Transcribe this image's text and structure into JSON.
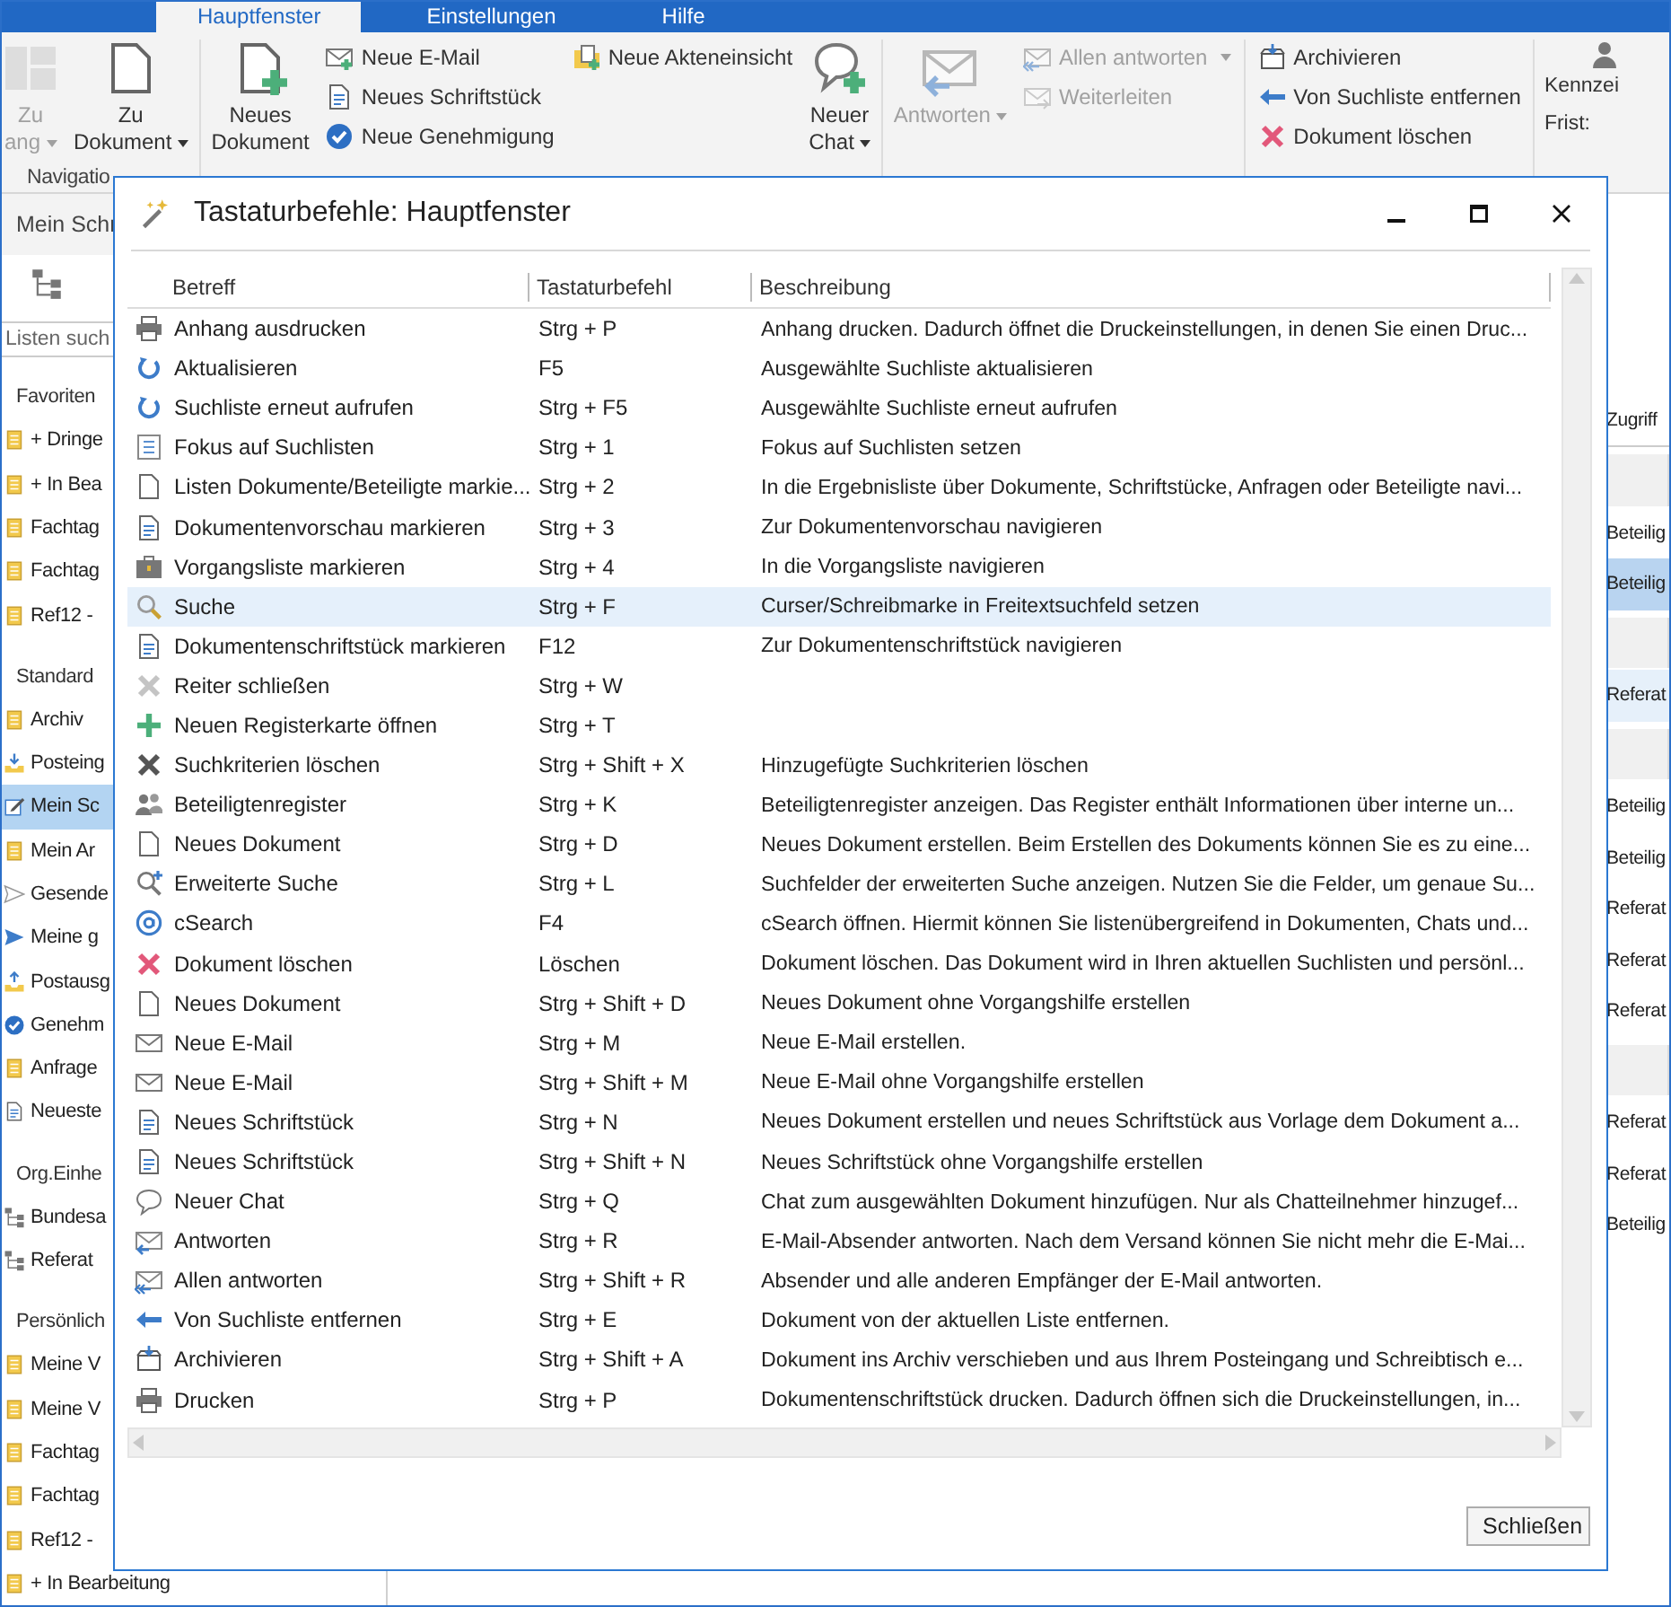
{
  "ribbon": {
    "tabs": [
      {
        "label": "Hauptfenster",
        "selected": true
      },
      {
        "label": "Einstellungen",
        "selected": false
      },
      {
        "label": "Hilfe",
        "selected": false
      }
    ],
    "groups": [
      {
        "label": "Navigatio",
        "columns": [
          {
            "kind": "large",
            "buttons": [
              {
                "kind": "panels",
                "lines": [
                  "Zu",
                  "ang"
                ],
                "dropdown": true,
                "disabled": true
              }
            ]
          },
          {
            "kind": "large",
            "buttons": [
              {
                "kind": "doc",
                "lines": [
                  "Zu",
                  "Dokument"
                ],
                "dropdown": true,
                "disabled": false
              }
            ]
          }
        ]
      },
      {
        "columns": [
          {
            "kind": "large",
            "buttons": [
              {
                "kind": "newdoc",
                "lines": [
                  "Neues",
                  "Dokument"
                ],
                "dropdown": false,
                "disabled": false
              }
            ]
          },
          {
            "kind": "stack",
            "buttons": [
              {
                "kind": "mailplus",
                "lines": [
                  "Neue E-Mail"
                ],
                "dropdown": false,
                "disabled": false
              },
              {
                "kind": "textdoc",
                "lines": [
                  "Neues Schriftstück"
                ],
                "dropdown": false,
                "disabled": false
              },
              {
                "kind": "check",
                "lines": [
                  "Neue Genehmigung"
                ],
                "dropdown": false,
                "disabled": false
              }
            ]
          },
          {
            "kind": "stack",
            "buttons": [
              {
                "kind": "folder",
                "lines": [
                  "Neue Akteneinsicht"
                ],
                "dropdown": false,
                "disabled": false
              }
            ]
          },
          {
            "kind": "large",
            "buttons": [
              {
                "kind": "chatplus",
                "lines": [
                  "Neuer",
                  "Chat"
                ],
                "dropdown": true,
                "disabled": false
              }
            ]
          }
        ]
      },
      {
        "columns": [
          {
            "kind": "large",
            "buttons": [
              {
                "kind": "reply",
                "lines": [
                  "Antworten"
                ],
                "dropdown": true,
                "disabled": true
              }
            ]
          },
          {
            "kind": "stack",
            "buttons": [
              {
                "kind": "replyall",
                "lines": [
                  "Allen antworten"
                ],
                "dropdown": true,
                "disabled": true
              },
              {
                "kind": "forward",
                "lines": [
                  "Weiterleiten"
                ],
                "dropdown": false,
                "disabled": true
              }
            ]
          }
        ]
      },
      {
        "columns": [
          {
            "kind": "stack",
            "buttons": [
              {
                "kind": "archive",
                "lines": [
                  "Archivieren"
                ],
                "dropdown": false,
                "disabled": false
              },
              {
                "kind": "arrowleft",
                "lines": [
                  "Von Suchliste entfernen"
                ],
                "dropdown": false,
                "disabled": false
              },
              {
                "kind": "xred",
                "lines": [
                  "Dokument löschen"
                ],
                "dropdown": false,
                "disabled": false
              }
            ]
          }
        ]
      },
      {
        "columns": [
          {
            "kind": "fields",
            "buttons": [
              {
                "kind": "person",
                "lines": [
                  "Kennzei"
                ]
              },
              {
                "kind": "none",
                "lines": [
                  "Frist:"
                ]
              }
            ]
          }
        ]
      }
    ]
  },
  "sidebar": {
    "tab": "Mein Schr",
    "search": {
      "placeholder": "Listen such"
    },
    "sections": [
      {
        "title": "Favoriten",
        "items": [
          {
            "label": "+ Dringe",
            "kind": "note",
            "selected": false
          },
          {
            "label": "+ In Bea",
            "kind": "note",
            "selected": false
          },
          {
            "label": "Fachtag",
            "kind": "note",
            "selected": false
          },
          {
            "label": "Fachtag",
            "kind": "note",
            "selected": false
          },
          {
            "label": "Ref12 -",
            "kind": "note",
            "selected": false
          }
        ]
      },
      {
        "title": "Standard",
        "items": [
          {
            "label": "Archiv",
            "kind": "note",
            "selected": false
          },
          {
            "label": "Posteing",
            "kind": "inbox",
            "selected": false
          },
          {
            "label": "Mein Sc",
            "kind": "edit",
            "selected": true
          },
          {
            "label": "Mein Ar",
            "kind": "note",
            "selected": false
          },
          {
            "label": "Gesende",
            "kind": "sendgray",
            "selected": false
          },
          {
            "label": "Meine g",
            "kind": "send",
            "selected": false
          },
          {
            "label": "Postausg",
            "kind": "outbox",
            "selected": false
          },
          {
            "label": "Genehm",
            "kind": "check",
            "selected": false
          },
          {
            "label": "Anfrage",
            "kind": "note",
            "selected": false
          },
          {
            "label": "Neueste",
            "kind": "textdoc",
            "selected": false
          }
        ]
      },
      {
        "title": "Org.Einhe",
        "items": [
          {
            "label": "Bundesa",
            "kind": "org",
            "selected": false
          },
          {
            "label": "Referat",
            "kind": "org",
            "selected": false
          }
        ]
      },
      {
        "title": "Persönlich",
        "items": [
          {
            "label": "Meine V",
            "kind": "note",
            "selected": false
          },
          {
            "label": "Meine V",
            "kind": "note",
            "selected": false
          },
          {
            "label": "Fachtag",
            "kind": "note",
            "selected": false
          },
          {
            "label": "Fachtag",
            "kind": "note",
            "selected": false
          },
          {
            "label": "Ref12 -",
            "kind": "note",
            "selected": false
          },
          {
            "label": "+ In Bearbeitung",
            "kind": "note",
            "selected": false
          }
        ]
      }
    ]
  },
  "result_list": {
    "column_heading": "Zugriff",
    "rows": [
      {
        "kind": "group"
      },
      {
        "kind": "item",
        "label": "Beteilig",
        "selected": false,
        "hovered": false
      },
      {
        "kind": "item",
        "label": "Beteilig",
        "selected": true,
        "hovered": false
      },
      {
        "kind": "group"
      },
      {
        "kind": "item",
        "label": "Referat",
        "selected": false,
        "hovered": true
      },
      {
        "kind": "group"
      },
      {
        "kind": "item",
        "label": "Beteilig",
        "selected": false,
        "hovered": false
      },
      {
        "kind": "item",
        "label": "Beteilig",
        "selected": false,
        "hovered": false
      },
      {
        "kind": "item",
        "label": "Referat",
        "selected": false,
        "hovered": false
      },
      {
        "kind": "item",
        "label": "Referat",
        "selected": false,
        "hovered": false
      },
      {
        "kind": "item",
        "label": "Referat",
        "selected": false,
        "hovered": false
      },
      {
        "kind": "group"
      },
      {
        "kind": "item",
        "label": "Referat",
        "selected": false,
        "hovered": false
      },
      {
        "kind": "item",
        "label": "Referat",
        "selected": false,
        "hovered": false
      },
      {
        "kind": "item",
        "label": "Beteilig",
        "selected": false,
        "hovered": false
      }
    ]
  },
  "dialog": {
    "title": "Tastaturbefehle: Hauptfenster",
    "columns": [
      "Betreff",
      "Tastaturbefehl",
      "Beschreibung"
    ],
    "rows": [
      {
        "kind": "print",
        "subject": "Anhang ausdrucken",
        "shortcut": "Strg + P",
        "description": "Anhang drucken. Dadurch öffnet die Druckeinstellungen, in denen Sie einen Druc...",
        "selected": false
      },
      {
        "kind": "refresh",
        "subject": "Aktualisieren",
        "shortcut": "F5",
        "description": "Ausgewählte Suchliste aktualisieren",
        "selected": false
      },
      {
        "kind": "refresh",
        "subject": "Suchliste erneut aufrufen",
        "shortcut": "Strg + F5",
        "description": "Ausgewählte Suchliste erneut aufrufen",
        "selected": false
      },
      {
        "kind": "list",
        "subject": "Fokus auf Suchlisten",
        "shortcut": "Strg + 1",
        "description": "Fokus auf Suchlisten setzen",
        "selected": false
      },
      {
        "kind": "doc",
        "subject": "Listen Dokumente/Beteiligte markie...",
        "shortcut": "Strg + 2",
        "description": "In die Ergebnisliste über Dokumente, Schriftstücke, Anfragen oder Beteiligte navi...",
        "selected": false
      },
      {
        "kind": "preview",
        "subject": "Dokumentenvorschau markieren",
        "shortcut": "Strg + 3",
        "description": "Zur Dokumentenvorschau navigieren",
        "selected": false
      },
      {
        "kind": "briefcase",
        "subject": "Vorgangsliste markieren",
        "shortcut": "Strg + 4",
        "description": "In die Vorgangsliste navigieren",
        "selected": false
      },
      {
        "kind": "search",
        "subject": "Suche",
        "shortcut": "Strg + F",
        "description": "Curser/Schreibmarke in Freitextsuchfeld setzen",
        "selected": true
      },
      {
        "kind": "textdoc",
        "subject": "Dokumentenschriftstück markieren",
        "shortcut": "F12",
        "description": "Zur Dokumentenschriftstück navigieren",
        "selected": false
      },
      {
        "kind": "xgray",
        "subject": "Reiter schließen",
        "shortcut": "Strg + W",
        "selected": false
      },
      {
        "kind": "plus",
        "subject": "Neuen Registerkarte öffnen",
        "shortcut": "Strg + T",
        "selected": false
      },
      {
        "kind": "xdark",
        "subject": "Suchkriterien löschen",
        "shortcut": "Strg + Shift + X",
        "description": "Hinzugefügte Suchkriterien löschen",
        "selected": false
      },
      {
        "kind": "people",
        "subject": "Beteiligtenregister",
        "shortcut": "Strg + K",
        "description": "Beteiligtenregister anzeigen. Das Register enthält Informationen über interne un...",
        "selected": false
      },
      {
        "kind": "doc",
        "subject": "Neues Dokument",
        "shortcut": "Strg + D",
        "description": "Neues Dokument erstellen. Beim Erstellen des Dokuments können Sie es zu eine...",
        "selected": false
      },
      {
        "kind": "searchplus",
        "subject": "Erweiterte Suche",
        "shortcut": "Strg + L",
        "description": "Suchfelder der erweiterten Suche anzeigen. Nutzen Sie die Felder, um genaue Su...",
        "selected": false
      },
      {
        "kind": "at",
        "subject": "cSearch",
        "shortcut": "F4",
        "description": "cSearch öffnen. Hiermit können Sie listenübergreifend in Dokumenten, Chats und...",
        "selected": false
      },
      {
        "kind": "xred",
        "subject": "Dokument löschen",
        "shortcut": "Löschen",
        "description": "Dokument löschen. Das Dokument wird in Ihren aktuellen Suchlisten und persönl...",
        "selected": false
      },
      {
        "kind": "doc",
        "subject": "Neues Dokument",
        "shortcut": "Strg + Shift + D",
        "description": "Neues Dokument ohne Vorgangshilfe erstellen",
        "selected": false
      },
      {
        "kind": "mail",
        "subject": "Neue E-Mail",
        "shortcut": "Strg + M",
        "description": "Neue E-Mail erstellen.",
        "selected": false
      },
      {
        "kind": "mail",
        "subject": "Neue E-Mail",
        "shortcut": "Strg + Shift + M",
        "description": "Neue E-Mail ohne Vorgangshilfe erstellen",
        "selected": false
      },
      {
        "kind": "textdoc",
        "subject": "Neues Schriftstück",
        "shortcut": "Strg + N",
        "description": "Neues Dokument erstellen und neues Schriftstück aus Vorlage dem Dokument a...",
        "selected": false
      },
      {
        "kind": "textdoc",
        "subject": "Neues Schriftstück",
        "shortcut": "Strg + Shift + N",
        "description": "Neues Schriftstück ohne Vorgangshilfe erstellen",
        "selected": false
      },
      {
        "kind": "chat",
        "subject": "Neuer Chat",
        "shortcut": "Strg + Q",
        "description": "Chat zum ausgewählten Dokument hinzufügen. Nur als Chatteilnehmer hinzugef...",
        "selected": false
      },
      {
        "kind": "reply",
        "subject": "Antworten",
        "shortcut": "Strg + R",
        "description": "E-Mail-Absender antworten. Nach dem Versand können Sie nicht mehr die E-Mai...",
        "selected": false
      },
      {
        "kind": "replyall",
        "subject": "Allen antworten",
        "shortcut": "Strg + Shift + R",
        "description": "Absender und alle anderen Empfänger der E-Mail antworten.",
        "selected": false
      },
      {
        "kind": "arrowleft",
        "subject": "Von Suchliste entfernen",
        "shortcut": "Strg + E",
        "description": "Dokument von der aktuellen Liste entfernen.",
        "selected": false
      },
      {
        "kind": "archive",
        "subject": "Archivieren",
        "shortcut": "Strg + Shift + A",
        "description": "Dokument ins Archiv verschieben und aus Ihrem Posteingang und Schreibtisch e...",
        "selected": false
      },
      {
        "kind": "print",
        "subject": "Drucken",
        "shortcut": "Strg + P",
        "description": "Dokumentenschriftstück drucken. Dadurch öffnen sich die Druckeinstellungen, in...",
        "selected": false
      }
    ],
    "button": "Schließen"
  }
}
